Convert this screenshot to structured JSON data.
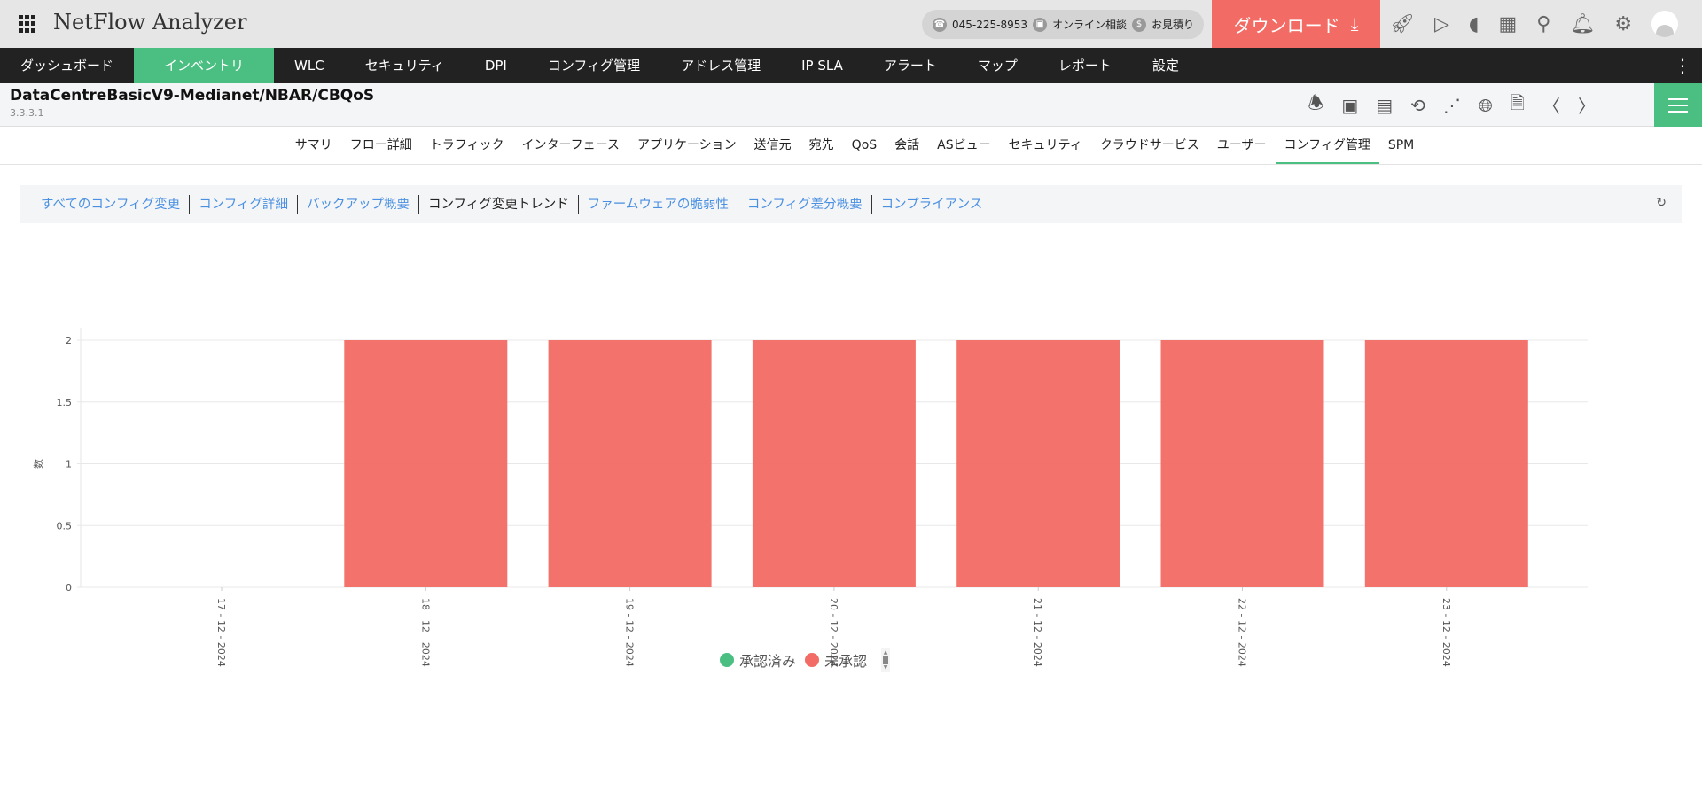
{
  "app": {
    "title": "NetFlow Analyzer"
  },
  "contact": {
    "phone": "045-225-8953",
    "online": "オンライン相談",
    "quote": "お見積り"
  },
  "download": {
    "label": "ダウンロード"
  },
  "nav": {
    "items": [
      "ダッシュボード",
      "インベントリ",
      "WLC",
      "セキュリティ",
      "DPI",
      "コンフィグ管理",
      "アドレス管理",
      "IP SLA",
      "アラート",
      "マップ",
      "レポート",
      "設定"
    ],
    "active": "インベントリ"
  },
  "device": {
    "name": "DataCentreBasicV9-Medianet/NBAR/CBQoS",
    "ip": "3.3.3.1"
  },
  "tabs": {
    "items": [
      "サマリ",
      "フロー詳細",
      "トラフィック",
      "インターフェース",
      "アプリケーション",
      "送信元",
      "宛先",
      "QoS",
      "会話",
      "ASビュー",
      "セキュリティ",
      "クラウドサービス",
      "ユーザー",
      "コンフィグ管理",
      "SPM"
    ],
    "active": "コンフィグ管理"
  },
  "subtabs": {
    "items": [
      "すべてのコンフィグ変更",
      "コンフィグ詳細",
      "バックアップ概要",
      "コンフィグ変更トレンド",
      "ファームウェアの脆弱性",
      "コンフィグ差分概要",
      "コンプライアンス"
    ],
    "active": "コンフィグ変更トレンド"
  },
  "colors": {
    "accent": "#4bbf82",
    "download": "#f26b64",
    "link": "#4a90e2",
    "approved": "#4bbf82",
    "unapproved": "#f26b64"
  },
  "chart_data": {
    "type": "bar",
    "ylabel": "数",
    "xlabel": "",
    "ylim": [
      0,
      2
    ],
    "yticks": [
      "0",
      "0.5",
      "1",
      "1.5",
      "2"
    ],
    "grid": true,
    "legend_placement": "bottom",
    "categories": [
      "17 - 12 - 2024",
      "18 - 12 - 2024",
      "19 - 12 - 2024",
      "20 - 12 - 2024",
      "21 - 12 - 2024",
      "22 - 12 - 2024",
      "23 - 12 - 2024"
    ],
    "series": [
      {
        "name": "承認済み",
        "color": "#4bbf82",
        "values": [
          0,
          0,
          0,
          0,
          0,
          0,
          0
        ]
      },
      {
        "name": "未承認",
        "color": "#f26b64",
        "values": [
          0,
          2,
          2,
          2,
          2,
          2,
          2
        ]
      }
    ]
  }
}
